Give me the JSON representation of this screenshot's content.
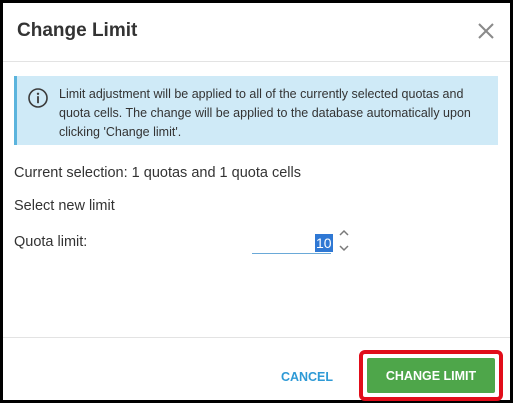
{
  "dialog": {
    "title": "Change Limit"
  },
  "info": {
    "text": "Limit adjustment will be applied to all of the currently selected quotas and quota cells. The change will be applied to the database automatically upon clicking 'Change limit'."
  },
  "body": {
    "current_selection": "Current selection: 1 quotas and 1 quota cells",
    "select_new_limit": "Select new limit",
    "quota_limit_label": "Quota limit:",
    "quota_limit_value": "10"
  },
  "footer": {
    "cancel_label": "CANCEL",
    "change_label": "CHANGE LIMIT"
  },
  "colors": {
    "accent_blue": "#2e9ad6",
    "info_background": "#cfeaf7",
    "primary_green": "#4ea64a",
    "highlight_red": "#e10d1a"
  },
  "icons": {
    "close": "close-icon",
    "info": "info-icon",
    "increment": "chevron-up-icon",
    "decrement": "chevron-down-icon"
  }
}
